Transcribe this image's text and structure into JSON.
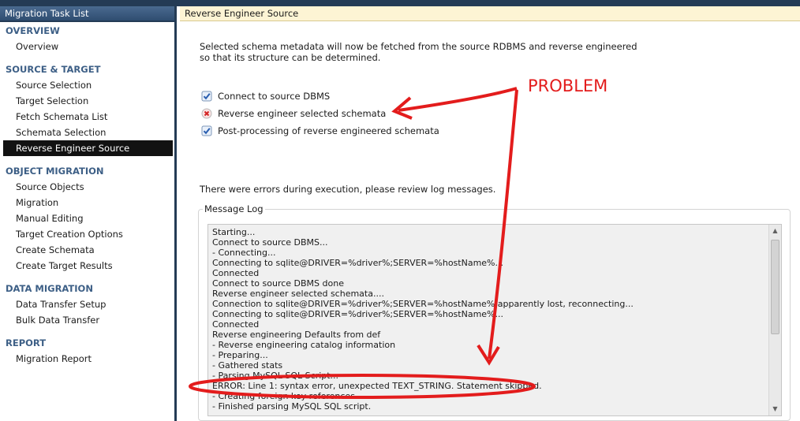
{
  "sidebar": {
    "title": "Migration Task List",
    "sections": [
      {
        "heading": "OVERVIEW",
        "items": [
          "Overview"
        ]
      },
      {
        "heading": "SOURCE & TARGET",
        "items": [
          "Source Selection",
          "Target Selection",
          "Fetch Schemata List",
          "Schemata Selection",
          "Reverse Engineer Source"
        ]
      },
      {
        "heading": "OBJECT MIGRATION",
        "items": [
          "Source Objects",
          "Migration",
          "Manual Editing",
          "Target Creation Options",
          "Create Schemata",
          "Create Target Results"
        ]
      },
      {
        "heading": "DATA MIGRATION",
        "items": [
          "Data Transfer Setup",
          "Bulk Data Transfer"
        ]
      },
      {
        "heading": "REPORT",
        "items": [
          "Migration Report"
        ]
      }
    ],
    "active_item": "Reverse Engineer Source"
  },
  "main": {
    "header": "Reverse Engineer Source",
    "description_line1": "Selected schema metadata will now be fetched from the source RDBMS and reverse engineered",
    "description_line2": "so that its structure can be determined.",
    "tasks": [
      {
        "label": "Connect to source DBMS",
        "status": "success",
        "icon": "check-icon"
      },
      {
        "label": "Reverse engineer selected schemata",
        "status": "error",
        "icon": "error-x-icon"
      },
      {
        "label": "Post-processing of reverse engineered schemata",
        "status": "success",
        "icon": "check-icon"
      }
    ],
    "errors_text": "There were errors during execution, please review log messages.",
    "message_log_title": "Message Log",
    "log_lines": [
      "Starting...",
      "Connect to source DBMS...",
      "- Connecting...",
      "Connecting to sqlite@DRIVER=%driver%;SERVER=%hostName%...",
      "Connected",
      "Connect to source DBMS done",
      "Reverse engineer selected schemata....",
      "Connection to sqlite@DRIVER=%driver%;SERVER=%hostName% apparently lost, reconnecting...",
      "Connecting to sqlite@DRIVER=%driver%;SERVER=%hostName%...",
      "Connected",
      "Reverse engineering Defaults from def",
      "- Reverse engineering catalog information",
      "- Preparing...",
      "- Gathered stats",
      "- Parsing MySQL SQL Script...",
      "ERROR: Line 1: syntax error, unexpected TEXT_STRING. Statement skipped.",
      "- Creating foreign key references",
      "- Finished parsing MySQL SQL script."
    ]
  },
  "annotation": {
    "label": "PROBLEM",
    "color": "#e31c1c"
  },
  "colors": {
    "sidebar_frame": "#243b55",
    "section_heading": "#3d5f86",
    "active_item_bg": "#121212",
    "header_bg": "#fdf4d4",
    "log_bg": "#f0f0f0"
  }
}
